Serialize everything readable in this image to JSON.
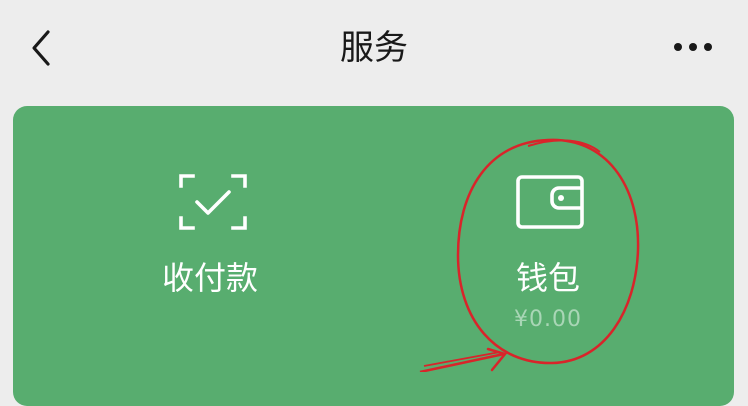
{
  "nav": {
    "title": "服务",
    "back_icon": "chevron-left-icon",
    "more_icon": "more-dots-icon"
  },
  "services": {
    "pay": {
      "label": "收付款",
      "icon": "scan-check-icon"
    },
    "wallet": {
      "label": "钱包",
      "balance": "¥0.00",
      "icon": "wallet-icon"
    }
  },
  "colors": {
    "background": "#ededed",
    "card": "#58ad6f",
    "annotation": "#d9242a"
  }
}
